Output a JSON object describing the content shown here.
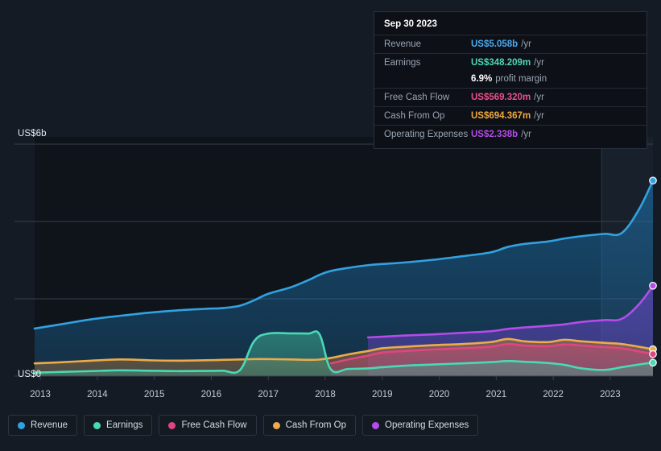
{
  "tooltip": {
    "title": "Sep 30 2023",
    "rows": [
      {
        "label": "Revenue",
        "value": "US$5.058b",
        "unit": "/yr",
        "color": "#4aaaf0"
      },
      {
        "label": "Earnings",
        "value": "US$348.209m",
        "unit": "/yr",
        "color": "#4ad9b5"
      },
      {
        "label": "",
        "value": "6.9%",
        "unit": "profit margin",
        "color": "#ffffff"
      },
      {
        "label": "Free Cash Flow",
        "value": "US$569.320m",
        "unit": "/yr",
        "color": "#e8508d"
      },
      {
        "label": "Cash From Op",
        "value": "US$694.367m",
        "unit": "/yr",
        "color": "#f0a93c"
      },
      {
        "label": "Operating Expenses",
        "value": "US$2.338b",
        "unit": "/yr",
        "color": "#b24ae8"
      }
    ]
  },
  "axis": {
    "y_top_label": "US$6b",
    "y_zero_label": "US$0",
    "x_ticks": [
      "2013",
      "2014",
      "2015",
      "2016",
      "2017",
      "2018",
      "2019",
      "2020",
      "2021",
      "2022",
      "2023"
    ]
  },
  "legend": {
    "items": [
      {
        "label": "Revenue",
        "color": "#33a1e0"
      },
      {
        "label": "Earnings",
        "color": "#4ad9b5"
      },
      {
        "label": "Free Cash Flow",
        "color": "#e0457f"
      },
      {
        "label": "Cash From Op",
        "color": "#edab4a"
      },
      {
        "label": "Operating Expenses",
        "color": "#b44ce8"
      }
    ]
  },
  "chart_data": {
    "type": "area",
    "title": "",
    "xlabel": "",
    "ylabel": "US$",
    "ylim": [
      0,
      6000
    ],
    "y_unit": "millions USD",
    "grid": true,
    "legend_position": "bottom",
    "x": [
      2012.9,
      2013.4,
      2013.9,
      2014.4,
      2014.9,
      2015.4,
      2015.9,
      2016.2,
      2016.5,
      2016.75,
      2017.0,
      2017.4,
      2017.7,
      2017.9,
      2018.1,
      2018.4,
      2018.75,
      2019.0,
      2019.4,
      2019.9,
      2020.4,
      2020.9,
      2021.2,
      2021.5,
      2021.9,
      2022.2,
      2022.5,
      2022.9,
      2023.2,
      2023.5,
      2023.75
    ],
    "x_tick_positions": [
      2013,
      2014,
      2015,
      2016,
      2017,
      2018,
      2019,
      2020,
      2021,
      2022,
      2023
    ],
    "forecast_start": 2022.85,
    "series": [
      {
        "name": "Revenue",
        "color": "#33a1e0",
        "values": [
          1230,
          1350,
          1470,
          1560,
          1640,
          1700,
          1740,
          1760,
          1820,
          1960,
          2130,
          2300,
          2480,
          2620,
          2720,
          2800,
          2870,
          2900,
          2940,
          3010,
          3100,
          3200,
          3340,
          3420,
          3480,
          3560,
          3620,
          3680,
          3700,
          4300,
          5058
        ]
      },
      {
        "name": "Operating Expenses",
        "color": "#b44ce8",
        "values": [
          null,
          null,
          null,
          null,
          null,
          null,
          null,
          null,
          null,
          null,
          null,
          null,
          null,
          null,
          null,
          null,
          1000,
          1020,
          1050,
          1080,
          1120,
          1160,
          1220,
          1260,
          1300,
          1340,
          1400,
          1450,
          1480,
          1850,
          2338
        ]
      },
      {
        "name": "Cash From Op",
        "color": "#edab4a",
        "values": [
          330,
          360,
          400,
          430,
          410,
          400,
          410,
          420,
          430,
          440,
          440,
          430,
          420,
          430,
          470,
          560,
          650,
          720,
          760,
          800,
          830,
          880,
          960,
          900,
          880,
          940,
          900,
          860,
          830,
          760,
          694
        ]
      },
      {
        "name": "Free Cash Flow",
        "color": "#e0457f",
        "values": [
          null,
          null,
          null,
          null,
          null,
          null,
          null,
          null,
          null,
          null,
          null,
          null,
          null,
          null,
          330,
          430,
          530,
          610,
          650,
          690,
          720,
          760,
          830,
          790,
          770,
          820,
          790,
          750,
          720,
          640,
          569
        ]
      },
      {
        "name": "Earnings",
        "color": "#4ad9b5",
        "values": [
          90,
          110,
          130,
          150,
          140,
          130,
          135,
          140,
          150,
          900,
          1100,
          1105,
          1100,
          1080,
          170,
          185,
          200,
          230,
          270,
          300,
          330,
          360,
          390,
          370,
          340,
          290,
          200,
          160,
          230,
          300,
          348
        ]
      }
    ]
  }
}
